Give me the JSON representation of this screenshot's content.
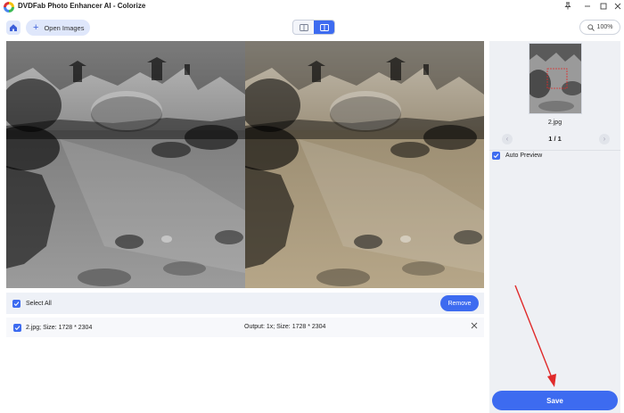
{
  "app": {
    "title": "DVDFab Photo Enhancer AI - Colorize",
    "window_controls": [
      "pin-icon",
      "minimize-icon",
      "maximize-icon",
      "close-icon"
    ]
  },
  "toolbar": {
    "home_icon": "home-icon",
    "open_images_label": "Open Images",
    "view_modes": [
      "single-view-icon",
      "split-view-icon"
    ],
    "active_view": "split-view",
    "zoom_label": "100%"
  },
  "selection": {
    "select_all_label": "Select All",
    "remove_label": "Remove"
  },
  "files": [
    {
      "name": "2.jpg; Size: 1728 * 2304",
      "output": "Output: 1x; Size: 1728 * 2304"
    }
  ],
  "sidebar": {
    "thumbnail_name": "2.jpg",
    "page_indicator": "1 / 1",
    "auto_preview_label": "Auto Preview",
    "save_label": "Save"
  },
  "colors": {
    "accent": "#3d6bf0",
    "annotation_arrow": "#e02a2a"
  }
}
